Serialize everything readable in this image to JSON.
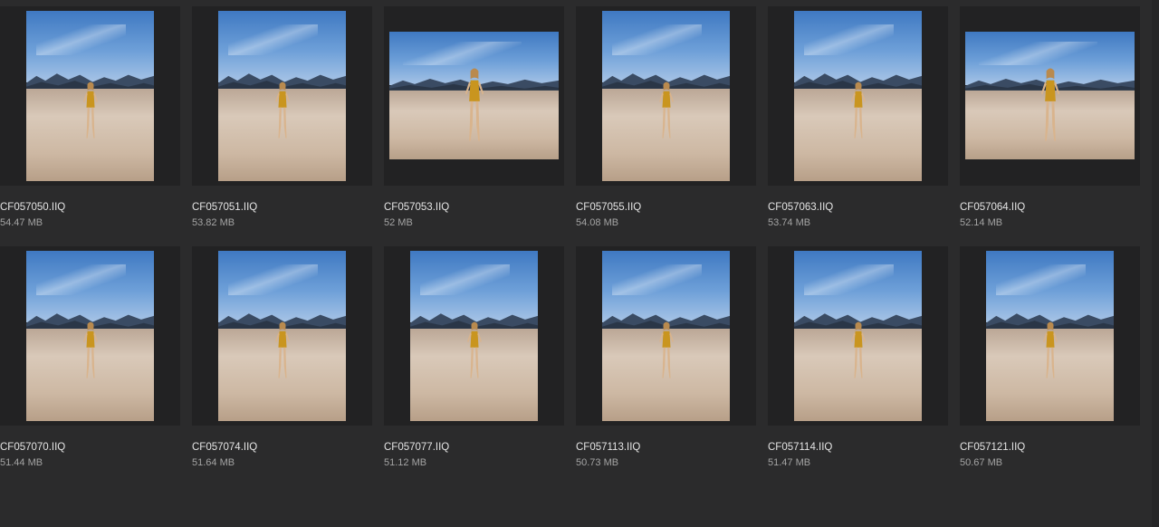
{
  "files": [
    {
      "name": "CF057050.IIQ",
      "size": "54.47 MB",
      "orientation": "portrait"
    },
    {
      "name": "CF057051.IIQ",
      "size": "53.82 MB",
      "orientation": "portrait"
    },
    {
      "name": "CF057053.IIQ",
      "size": "52 MB",
      "orientation": "landscape"
    },
    {
      "name": "CF057055.IIQ",
      "size": "54.08 MB",
      "orientation": "portrait"
    },
    {
      "name": "CF057063.IIQ",
      "size": "53.74 MB",
      "orientation": "portrait"
    },
    {
      "name": "CF057064.IIQ",
      "size": "52.14 MB",
      "orientation": "landscape"
    },
    {
      "name": "CF057070.IIQ",
      "size": "51.44 MB",
      "orientation": "portrait"
    },
    {
      "name": "CF057074.IIQ",
      "size": "51.64 MB",
      "orientation": "portrait"
    },
    {
      "name": "CF057077.IIQ",
      "size": "51.12 MB",
      "orientation": "portrait"
    },
    {
      "name": "CF057113.IIQ",
      "size": "50.73 MB",
      "orientation": "portrait"
    },
    {
      "name": "CF057114.IIQ",
      "size": "51.47 MB",
      "orientation": "portrait"
    },
    {
      "name": "CF057121.IIQ",
      "size": "50.67 MB",
      "orientation": "portrait"
    }
  ],
  "colors": {
    "background": "#2b2b2c",
    "frame": "#222223",
    "name_text": "#e4e4e4",
    "size_text": "#a4a4a4",
    "swimsuit": "#c9951f"
  }
}
